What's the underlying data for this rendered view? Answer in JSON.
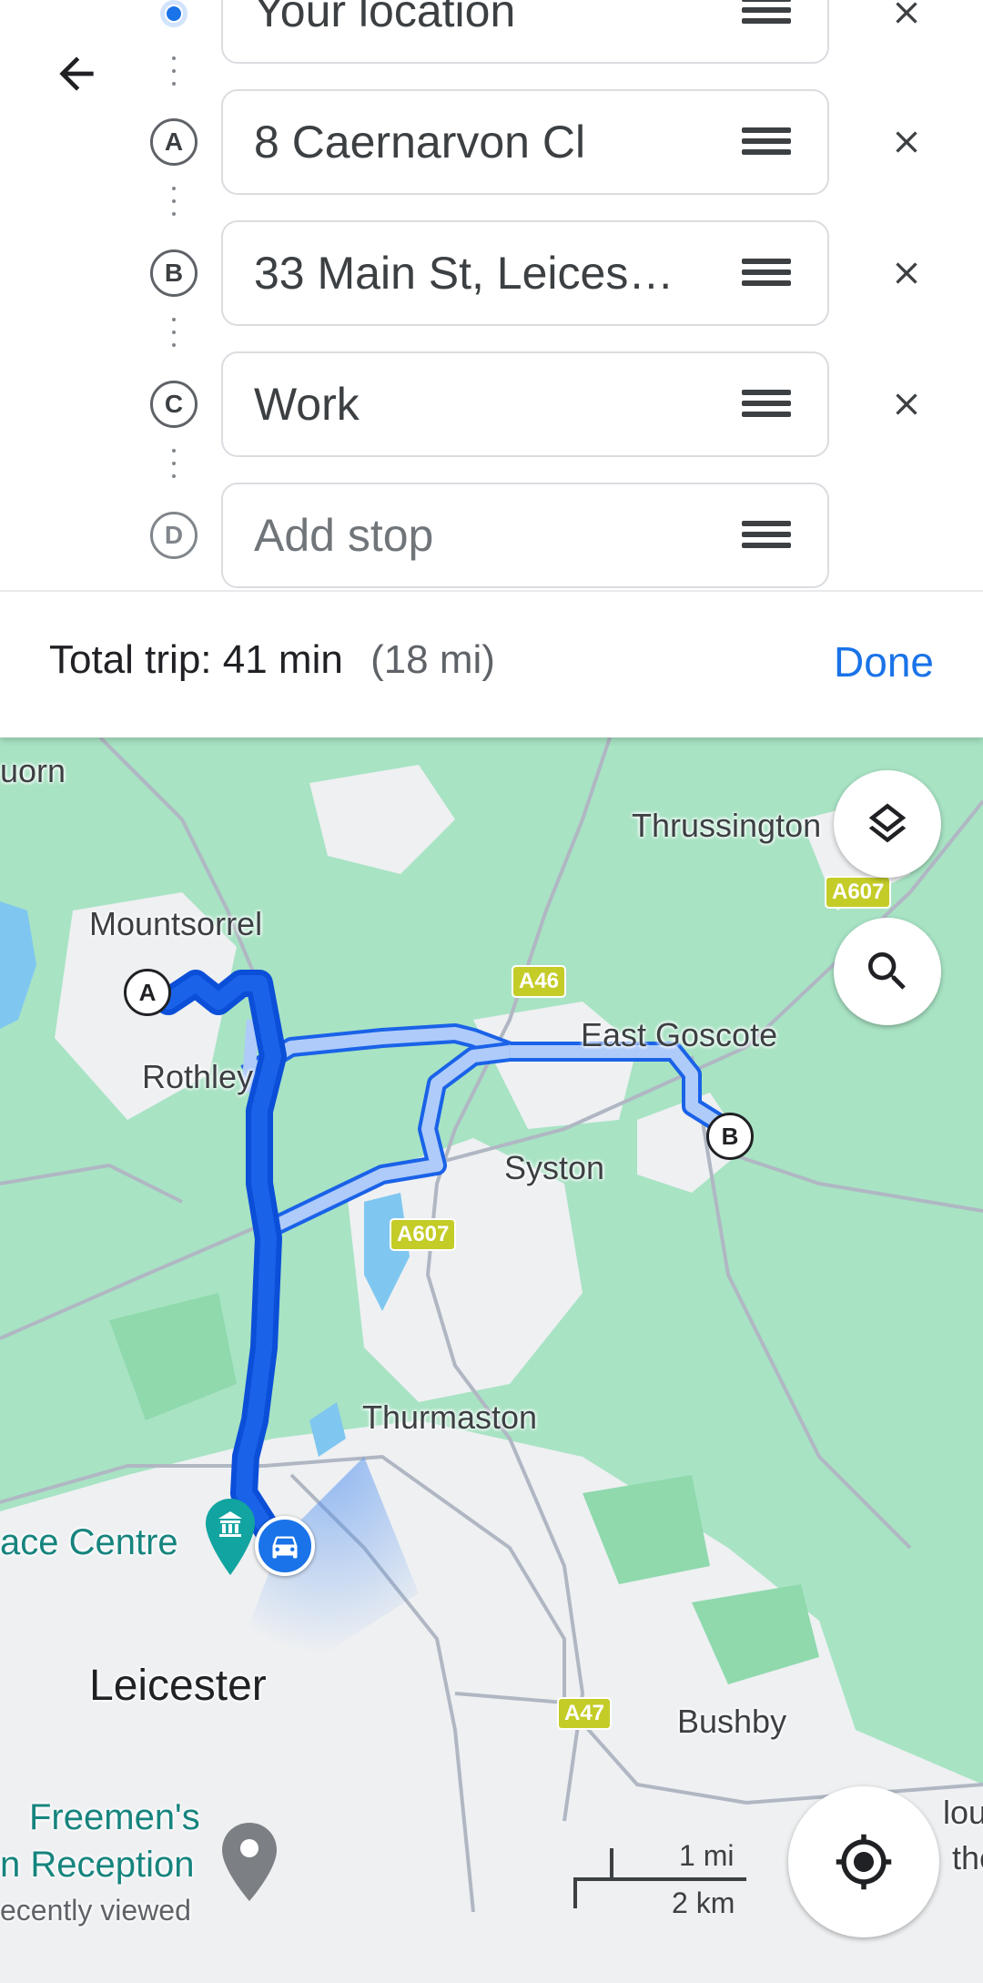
{
  "stops": [
    {
      "label": "Your location",
      "marker": "",
      "type": "current-location",
      "removable": true
    },
    {
      "label": "8 Caernarvon Cl",
      "marker": "A",
      "type": "stop",
      "removable": true
    },
    {
      "label": "33 Main St, Leices…",
      "marker": "B",
      "type": "stop",
      "removable": true
    },
    {
      "label": "Work",
      "marker": "C",
      "type": "stop",
      "removable": true
    },
    {
      "label": "",
      "marker": "D",
      "type": "add",
      "placeholder": "Add stop",
      "removable": false
    }
  ],
  "summary": {
    "prefix": "Total trip:",
    "duration": "41 min",
    "distance": "(18 mi)",
    "done_label": "Done"
  },
  "map": {
    "labels": {
      "quorn": "uorn",
      "mountsorrel": "Mountsorrel",
      "rothley": "Rothley",
      "thrussington": "Thrussington",
      "east_goscote": "East Goscote",
      "syston": "Syston",
      "thurmaston": "Thurmaston",
      "space_centre": "ace Centre",
      "leicester": "Leicester",
      "freemens": "Freemen's",
      "reception": "n Reception",
      "recently_viewed": "ecently viewed",
      "bushby": "Bushby",
      "oughton": "loug",
      "the": "the"
    },
    "road_badges": {
      "a46": "A46",
      "a607_top": "A607",
      "a607_mid": "A607",
      "a47": "A47"
    },
    "markers": {
      "a": "A",
      "b": "B"
    },
    "scale": {
      "mi": "1 mi",
      "km": "2 km"
    },
    "route_color": "#1a62e8",
    "alt_route_color": "#aecbfa"
  },
  "icons": {
    "back": "arrow-left-icon",
    "layers": "layers-icon",
    "search": "search-icon",
    "locate": "my-location-icon",
    "remove": "close-icon",
    "drag": "drag-handle-icon",
    "car": "car-icon",
    "museum": "museum-icon",
    "place": "place-pin-icon"
  }
}
